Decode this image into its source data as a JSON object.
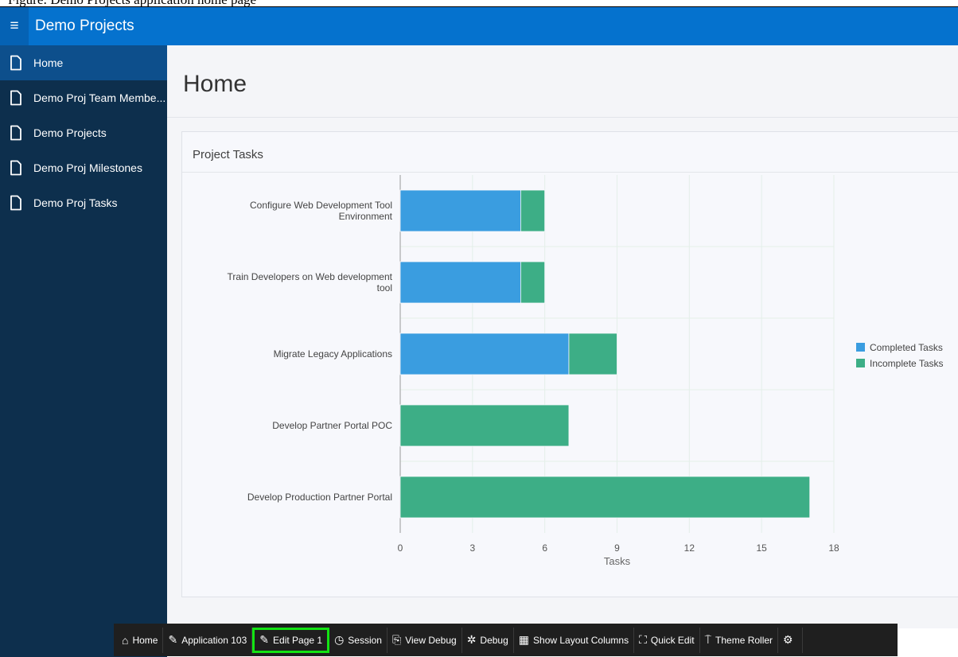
{
  "caption": "Figure: Demo Projects application home page",
  "header": {
    "app_title": "Demo Projects"
  },
  "sidebar": {
    "items": [
      {
        "label": "Home",
        "active": true
      },
      {
        "label": "Demo Proj Team Membe..."
      },
      {
        "label": "Demo Projects"
      },
      {
        "label": "Demo Proj Milestones"
      },
      {
        "label": "Demo Proj Tasks"
      }
    ]
  },
  "main": {
    "page_title": "Home",
    "region_title": "Project Tasks"
  },
  "chart_data": {
    "type": "bar",
    "orientation": "horizontal",
    "stacked": true,
    "categories": [
      [
        "Configure Web Development Tool",
        "Environment"
      ],
      [
        "Train Developers on Web development",
        "tool"
      ],
      [
        "Migrate Legacy Applications"
      ],
      [
        "Develop Partner Portal POC"
      ],
      [
        "Develop Production Partner Portal"
      ]
    ],
    "series": [
      {
        "name": "Completed Tasks",
        "color": "#3a9de0",
        "values": [
          5,
          5,
          7,
          0,
          0
        ]
      },
      {
        "name": "Incomplete Tasks",
        "color": "#3dae86",
        "values": [
          1,
          1,
          2,
          7,
          17
        ]
      }
    ],
    "xlabel": "Tasks",
    "xlim": [
      0,
      18
    ],
    "xticks": [
      0,
      3,
      6,
      9,
      12,
      15,
      18
    ],
    "grid": true,
    "legend": "right"
  },
  "devbar": {
    "items": [
      {
        "label": "Home",
        "icon": "home-icon",
        "glyph": "⌂"
      },
      {
        "label": "Application 103",
        "icon": "edit-app-icon",
        "glyph": "✎"
      },
      {
        "label": "Edit Page 1",
        "icon": "edit-page-icon",
        "glyph": "✎",
        "highlight": true
      },
      {
        "label": "Session",
        "icon": "clock-icon",
        "glyph": "◷"
      },
      {
        "label": "View Debug",
        "icon": "view-debug-icon",
        "glyph": "⎘"
      },
      {
        "label": "Debug",
        "icon": "bug-icon",
        "glyph": "✲"
      },
      {
        "label": "Show Layout Columns",
        "icon": "grid-icon",
        "glyph": "▦"
      },
      {
        "label": "Quick Edit",
        "icon": "cursor-icon",
        "glyph": "⛶"
      },
      {
        "label": "Theme Roller",
        "icon": "paint-roller-icon",
        "glyph": "⍑"
      },
      {
        "label": "",
        "icon": "gear-icon",
        "glyph": "⚙"
      }
    ]
  }
}
